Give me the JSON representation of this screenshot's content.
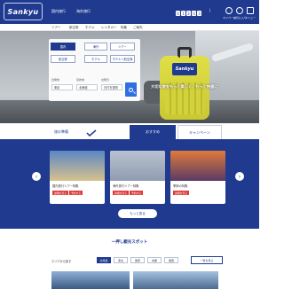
{
  "header": {
    "logo": "Sankyu",
    "links": [
      "国内旅行",
      "海外旅行"
    ],
    "phone_digits": [
      "0",
      "1",
      "2",
      "0",
      "3"
    ],
    "icons": [
      {
        "name": "user-icon",
        "label": "マイページ"
      },
      {
        "name": "heart-icon",
        "label": "お気に入り"
      },
      {
        "name": "menu-icon",
        "label": "メニュー"
      }
    ]
  },
  "nav": {
    "items": [
      "ツアー",
      "航空券",
      "ホテル",
      "レンタカー",
      "特集",
      "ご案内"
    ]
  },
  "hero": {
    "catch": "大切な旅をもっと楽しく、もっと快適に",
    "suitcase_tag": "Sankyu"
  },
  "search": {
    "options": [
      "国内",
      "海外",
      "ツアー",
      "航空券",
      "ホテル",
      "ホテル＋航空券"
    ],
    "fields": [
      {
        "label": "出発地",
        "value": "東京"
      },
      {
        "label": "目的地",
        "value": "北海道"
      },
      {
        "label": "出発日",
        "value": "日付を選択"
      }
    ]
  },
  "tabs": [
    "旅の準備",
    "おすすめ",
    "キャンペーン"
  ],
  "promo": {
    "cards": [
      {
        "caption": "国内旅行ツアー特集",
        "buttons": [
          "詳細を見る",
          "予約する"
        ],
        "colors": [
          "#5b87c4",
          "#d7c28d"
        ]
      },
      {
        "caption": "海外旅行ツアー特集",
        "buttons": [
          "詳細を見る",
          "予約する"
        ],
        "colors": [
          "#b9c2cf",
          "#8f9bb0"
        ]
      },
      {
        "caption": "季節の特集",
        "buttons": [
          "詳細を見る"
        ],
        "colors": [
          "#e07a3a",
          "#5a3b66"
        ]
      }
    ],
    "more_label": "もっと見る"
  },
  "lower": {
    "title": "一押し観光スポット",
    "sub_label": "エリアから探す",
    "dest_tabs": [
      "北海道",
      "東北",
      "関東",
      "中部",
      "関西"
    ],
    "active_tab": 0,
    "list_label": "一覧を見る"
  },
  "colors": {
    "brand": "#1f3a8f",
    "accent": "#2f6fe0",
    "red": "#e03a3a"
  }
}
